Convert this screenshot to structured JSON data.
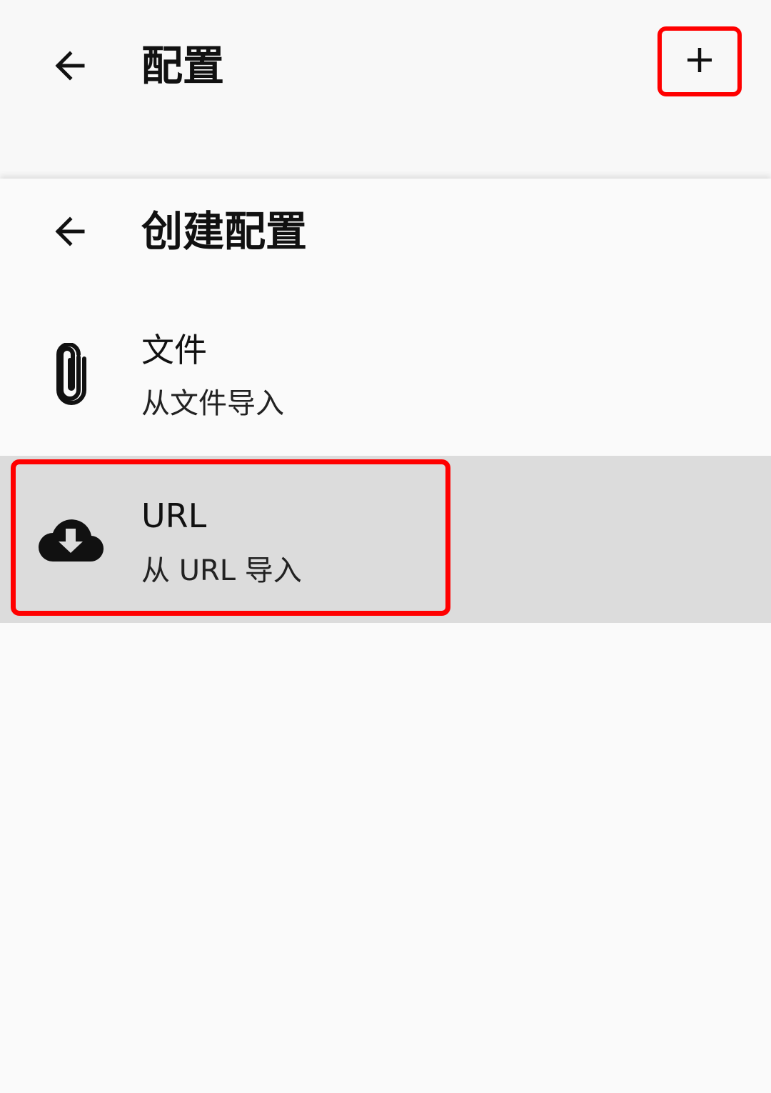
{
  "top_bar": {
    "title": "配置",
    "back_icon": "arrow-left-icon",
    "add_icon": "plus-icon"
  },
  "sheet": {
    "title": "创建配置",
    "back_icon": "arrow-left-icon",
    "items": [
      {
        "label": "文件",
        "subtitle": "从文件导入",
        "icon": "paperclip-icon"
      },
      {
        "label": "URL",
        "subtitle": "从 URL 导入",
        "icon": "cloud-download-icon"
      }
    ]
  },
  "colors": {
    "highlight": "#ff0000",
    "selected_row": "#dcdcdc",
    "background": "#fafafa"
  }
}
